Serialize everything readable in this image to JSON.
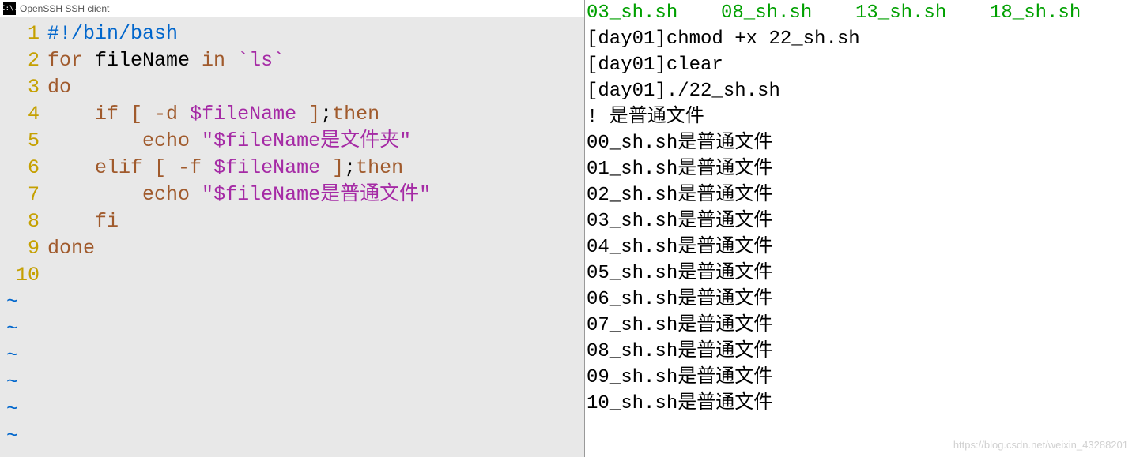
{
  "window": {
    "title": "OpenSSH SSH client",
    "icon_label": "C:\\."
  },
  "editor": {
    "lines": [
      {
        "num": "1",
        "tokens": [
          {
            "t": "#!/bin/bash",
            "c": "c-bluegrey"
          }
        ]
      },
      {
        "num": "2",
        "tokens": [
          {
            "t": "for ",
            "c": "c-brown"
          },
          {
            "t": "fileName ",
            "c": "c-black"
          },
          {
            "t": "in ",
            "c": "c-brown"
          },
          {
            "t": "`ls`",
            "c": "c-purple"
          }
        ]
      },
      {
        "num": "3",
        "tokens": [
          {
            "t": "do",
            "c": "c-brown"
          }
        ]
      },
      {
        "num": "4",
        "tokens": [
          {
            "t": "    if ",
            "c": "c-brown"
          },
          {
            "t": "[ ",
            "c": "c-brown"
          },
          {
            "t": "-d ",
            "c": "c-brown"
          },
          {
            "t": "$fileName",
            "c": "c-purple"
          },
          {
            "t": " ]",
            "c": "c-brown"
          },
          {
            "t": ";",
            "c": "c-black"
          },
          {
            "t": "then",
            "c": "c-brown"
          }
        ]
      },
      {
        "num": "5",
        "tokens": [
          {
            "t": "        echo ",
            "c": "c-brown"
          },
          {
            "t": "\"",
            "c": "c-purple"
          },
          {
            "t": "$fileName",
            "c": "c-purple"
          },
          {
            "t": "是文件夹\"",
            "c": "c-purple"
          }
        ]
      },
      {
        "num": "6",
        "tokens": [
          {
            "t": "    elif ",
            "c": "c-brown"
          },
          {
            "t": "[ ",
            "c": "c-brown"
          },
          {
            "t": "-f ",
            "c": "c-brown"
          },
          {
            "t": "$fileName",
            "c": "c-purple"
          },
          {
            "t": " ]",
            "c": "c-brown"
          },
          {
            "t": ";",
            "c": "c-black"
          },
          {
            "t": "then",
            "c": "c-brown"
          }
        ]
      },
      {
        "num": "7",
        "tokens": [
          {
            "t": "        echo ",
            "c": "c-brown"
          },
          {
            "t": "\"",
            "c": "c-purple"
          },
          {
            "t": "$fileName",
            "c": "c-purple"
          },
          {
            "t": "是普通文件\"",
            "c": "c-purple"
          }
        ]
      },
      {
        "num": "8",
        "tokens": [
          {
            "t": "    fi",
            "c": "c-brown"
          }
        ]
      },
      {
        "num": "9",
        "tokens": [
          {
            "t": "done",
            "c": "c-brown"
          }
        ]
      },
      {
        "num": "10",
        "tokens": [
          {
            "t": "",
            "c": "c-black"
          }
        ]
      }
    ],
    "tilde": "~",
    "tilde_count": 6
  },
  "terminal": {
    "top_green_row": [
      "03_sh.sh",
      "08_sh.sh",
      "13_sh.sh",
      "18_sh.sh"
    ],
    "cmds": [
      "[day01]chmod +x 22_sh.sh",
      "[day01]clear",
      "[day01]./22_sh.sh"
    ],
    "exclaim": "! 是普通文件",
    "outputs": [
      "00_sh.sh是普通文件",
      "01_sh.sh是普通文件",
      "02_sh.sh是普通文件",
      "03_sh.sh是普通文件",
      "04_sh.sh是普通文件",
      "05_sh.sh是普通文件",
      "06_sh.sh是普通文件",
      "07_sh.sh是普通文件",
      "08_sh.sh是普通文件",
      "09_sh.sh是普通文件",
      "10_sh.sh是普通文件"
    ]
  },
  "watermark": "https://blog.csdn.net/weixin_43288201"
}
